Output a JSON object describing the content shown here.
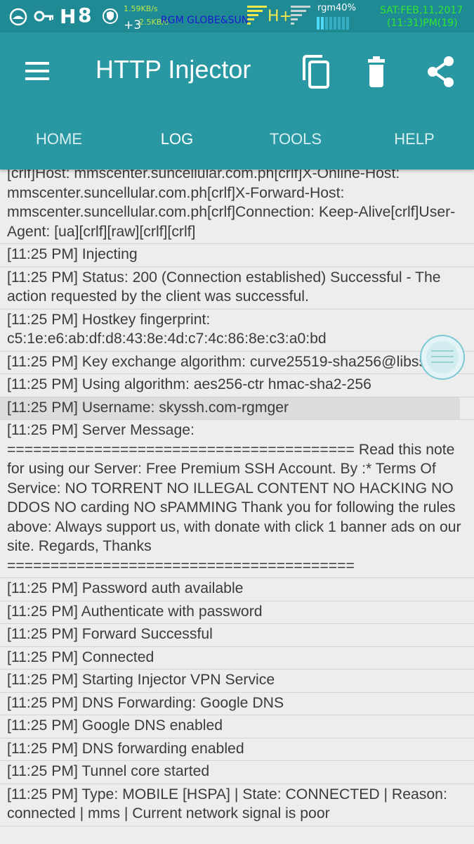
{
  "status_bar": {
    "network_speed_up": "1.59KB/s",
    "network_speed_down": "2.5KB/s",
    "notification_count": "+3",
    "carrier": "RGM GLOBE&SUN",
    "network_type": "H+",
    "battery_label": "rgm40%",
    "date": "SAT:FEB,11,2017",
    "time": "(11:31)PM(19)",
    "colors": {
      "background": "#1f8a93",
      "carrier": "#1a1acc",
      "network_type": "#f2e84a",
      "date": "#32e632"
    }
  },
  "app_bar": {
    "title": "HTTP Injector",
    "icons": [
      "menu-icon",
      "copy-icon",
      "delete-icon",
      "share-icon"
    ],
    "colors": {
      "background": "#2a98a2"
    }
  },
  "tabs": [
    {
      "label": "HOME",
      "active": false
    },
    {
      "label": "LOG",
      "active": true
    },
    {
      "label": "TOOLS",
      "active": false
    },
    {
      "label": "HELP",
      "active": false
    }
  ],
  "log": {
    "entries": [
      "[crlf]Host: mmscenter.suncellular.com.ph[crlf]X-Online-Host: mmscenter.suncellular.com.ph[crlf]X-Forward-Host: mmscenter.suncellular.com.ph[crlf]Connection: Keep-Alive[crlf]User-Agent: [ua][crlf][raw][crlf][crlf]",
      "[11:25 PM] Injecting",
      "[11:25 PM] Status: 200 (Connection established) Successful - The action requested by the client was successful.",
      "[11:25 PM] Hostkey fingerprint: c5:1e:e6:ab:df:d8:43:8e:4d:c7:4c:86:8e:c3:a0:bd",
      "[11:25 PM] Key exchange algorithm: curve25519-sha256@libssh.org",
      "[11:25 PM] Using algorithm: aes256-ctr hmac-sha2-256",
      "[11:25 PM] Username: skyssh.com-rgmger",
      "[11:25 PM] Server Message: ======================================== Read this note for using our Server: Free Premium SSH Account. By :* Terms Of Service: NO TORRENT NO ILLEGAL CONTENT NO HACKING NO DDOS NO carding NO sPAMMING Thank you for following the rules above: Always support us, with donate with click 1 banner ads on our site. Regards, Thanks ========================================",
      "[11:25 PM] Password auth available",
      "[11:25 PM] Authenticate with password",
      "[11:25 PM] Forward Successful",
      "[11:25 PM] Connected",
      "[11:25 PM] Starting Injector VPN Service",
      "[11:25 PM] DNS Forwarding: Google DNS",
      "[11:25 PM] Google DNS enabled",
      "[11:25 PM] DNS forwarding enabled",
      "[11:25 PM] Tunnel core started",
      "[11:25 PM] Type: MOBILE [HSPA] | State: CONNECTED | Reason: connected | mms | Current network signal is poor"
    ],
    "highlighted_index": 6
  }
}
